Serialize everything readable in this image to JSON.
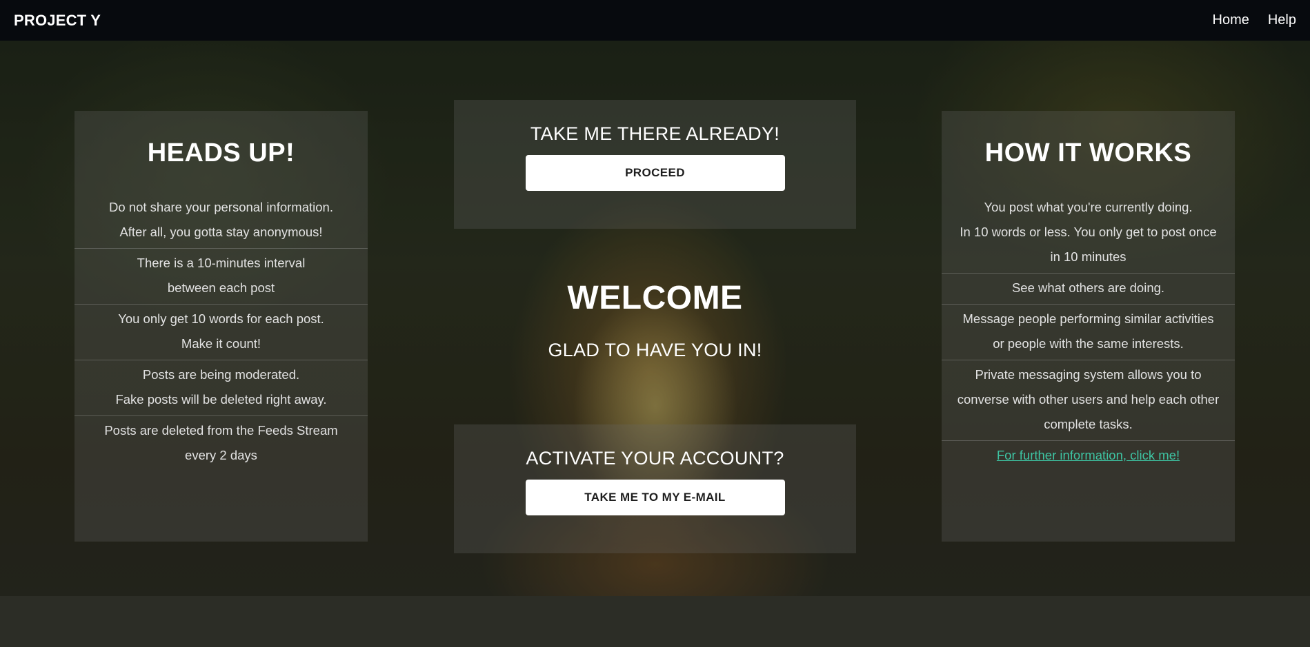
{
  "navbar": {
    "brand": "PROJECT Y",
    "links": [
      "Home",
      "Help"
    ]
  },
  "heads_up": {
    "title": "HEADS UP!",
    "items": [
      [
        "Do not share your personal information.",
        "After all, you gotta stay anonymous!"
      ],
      [
        "There is a 10-minutes interval",
        "between each post"
      ],
      [
        "You only get 10 words for each post.",
        "Make it count!"
      ],
      [
        "Posts are being moderated.",
        "Fake posts will be deleted right away."
      ],
      [
        "Posts are deleted from the Feeds Stream",
        "every 2 days"
      ]
    ]
  },
  "proceed_cta": {
    "heading": "TAKE ME THERE ALREADY!",
    "button": "PROCEED"
  },
  "welcome": {
    "title": "WELCOME",
    "subtitle": "GLAD TO HAVE YOU IN!"
  },
  "activate_cta": {
    "heading": "ACTIVATE YOUR ACCOUNT?",
    "button": "TAKE ME TO MY E-MAIL"
  },
  "how_it_works": {
    "title": "HOW IT WORKS",
    "items": [
      [
        "You post what you're currently doing.",
        "In 10 words or less. You only get to post once",
        "in 10 minutes"
      ],
      [
        "See what others are doing."
      ],
      [
        "Message people performing similar activities",
        "or people with the same interests."
      ],
      [
        "Private messaging system allows you to",
        "converse with other users and help each other",
        "complete tasks."
      ]
    ],
    "link": "For further information, click me!"
  },
  "colors": {
    "navbar_bg": "#070a0e",
    "link_accent": "#3ec4a3",
    "button_bg": "#ffffff"
  }
}
